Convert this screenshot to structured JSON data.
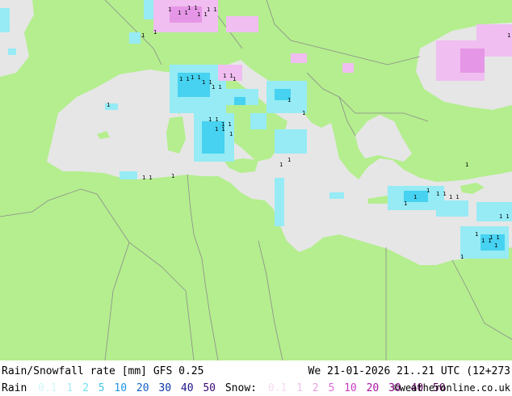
{
  "title": "Rain/Snowfall rate [mm] GFS 0.25",
  "datetime": "We 21-01-2026 21..21 UTC (12+273",
  "credit": "©weatheronline.co.uk",
  "legend": {
    "rain_label": "Rain",
    "rain_levels": [
      {
        "text": "0.1",
        "color": "#d2f5fa"
      },
      {
        "text": "1",
        "color": "#a5ebf5"
      },
      {
        "text": "2",
        "color": "#6ee1f0"
      },
      {
        "text": "5",
        "color": "#46c8eb"
      },
      {
        "text": "10",
        "color": "#1e96e6"
      },
      {
        "text": "20",
        "color": "#1464c8"
      },
      {
        "text": "30",
        "color": "#0a32aa"
      },
      {
        "text": "40",
        "color": "#1e148c"
      },
      {
        "text": "50",
        "color": "#3c0a78"
      }
    ],
    "snow_label": "Snow:",
    "snow_levels": [
      {
        "text": "0.1",
        "color": "#f5dcf0"
      },
      {
        "text": "1",
        "color": "#f0c3eb"
      },
      {
        "text": "2",
        "color": "#e6a0e1"
      },
      {
        "text": "5",
        "color": "#dc6ed7"
      },
      {
        "text": "10",
        "color": "#c83cc3"
      },
      {
        "text": "20",
        "color": "#aa14a5"
      },
      {
        "text": "30",
        "color": "#8c0a8c"
      },
      {
        "text": "40",
        "color": "#6e0a6e"
      },
      {
        "text": "50",
        "color": "#500050"
      }
    ]
  },
  "colors": {
    "land": "#b4ee8e",
    "sea": "#e6e6e6",
    "border": "#8c8c8c",
    "rain_light": "#96ebf5",
    "rain_medium": "#46d2f0",
    "snow_light": "#f0bef0",
    "snow_medium": "#e696e6",
    "cell_marker": "#000000"
  }
}
